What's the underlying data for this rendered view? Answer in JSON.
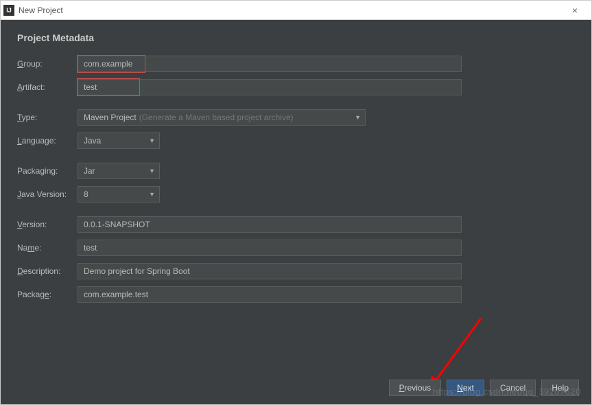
{
  "titlebar": {
    "icon_text": "IJ",
    "title": "New Project",
    "close": "×"
  },
  "heading": "Project Metadata",
  "labels": {
    "group": "Group:",
    "artifact": "Artifact:",
    "type": "Type:",
    "language": "Language:",
    "packaging": "Packaging:",
    "java_version": "Java Version:",
    "version": "Version:",
    "name": "Name:",
    "description": "Description:",
    "package": "Package:"
  },
  "values": {
    "group": "com.example",
    "artifact": "test",
    "type": "Maven Project",
    "type_hint": "(Generate a Maven based project archive)",
    "language": "Java",
    "packaging": "Jar",
    "java_version": "8",
    "version": "0.0.1-SNAPSHOT",
    "name": "test",
    "description": "Demo project for Spring Boot",
    "package": "com.example.test"
  },
  "buttons": {
    "previous": "Previous",
    "next": "Next",
    "cancel": "Cancel",
    "help": "Help"
  },
  "watermark": "https://blog.csdn.net/qq_39207620"
}
